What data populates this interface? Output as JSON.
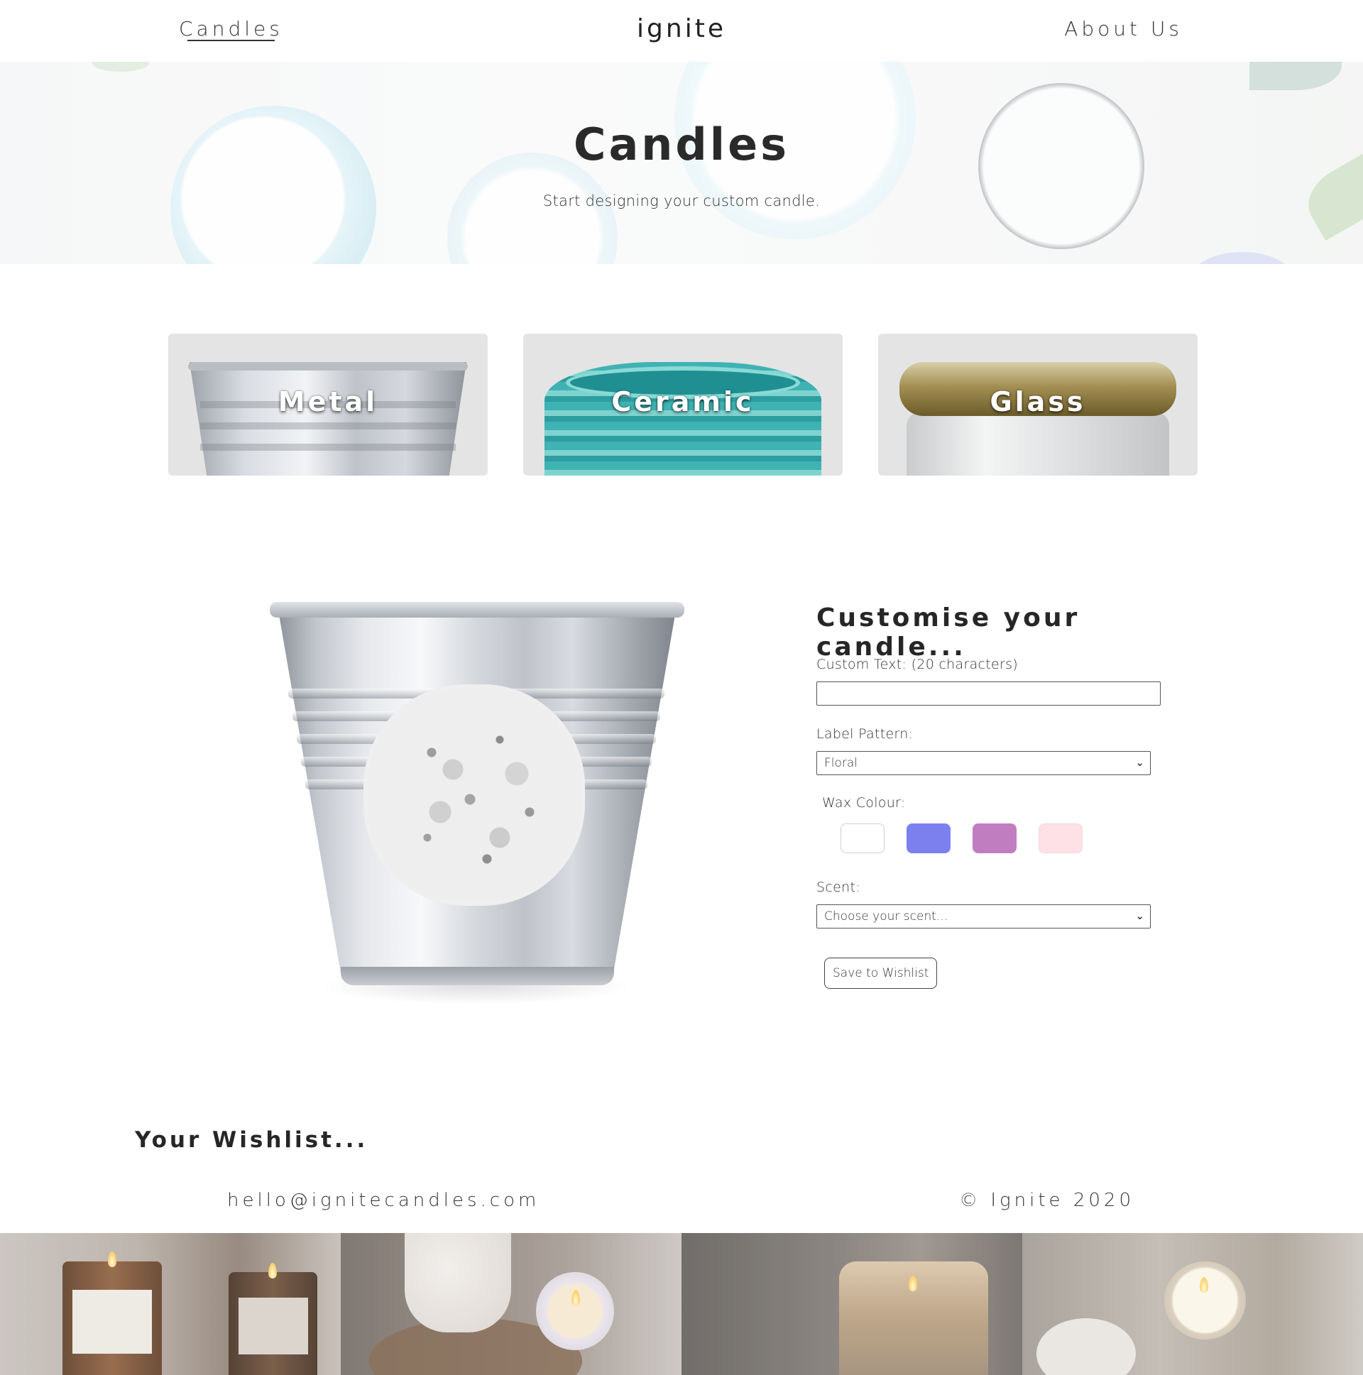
{
  "nav": {
    "candles_label": "Candles",
    "brand": "ignite",
    "about_label": "About Us"
  },
  "hero": {
    "title": "Candles",
    "subtitle": "Start designing your custom candle."
  },
  "materials": [
    {
      "label": "Metal"
    },
    {
      "label": "Ceramic"
    },
    {
      "label": "Glass"
    }
  ],
  "customise": {
    "heading": "Customise your candle...",
    "custom_text_label": "Custom Text: (20 characters)",
    "custom_text_value": "",
    "label_pattern_label": "Label Pattern:",
    "label_pattern_selected": "Floral",
    "wax_colour_label": "Wax Colour:",
    "wax_colours": [
      "#ffffff",
      "#7c80ef",
      "#c07ec0",
      "#fde1e6"
    ],
    "scent_label": "Scent:",
    "scent_selected": "Choose your scent...",
    "save_button": "Save to Wishlist"
  },
  "wishlist": {
    "title": "Your Wishlist..."
  },
  "footer": {
    "email": "hello@ignitecandles.com",
    "copyright": "© Ignite 2020"
  },
  "icons": {
    "select_caret": "chevron-down-icon"
  }
}
